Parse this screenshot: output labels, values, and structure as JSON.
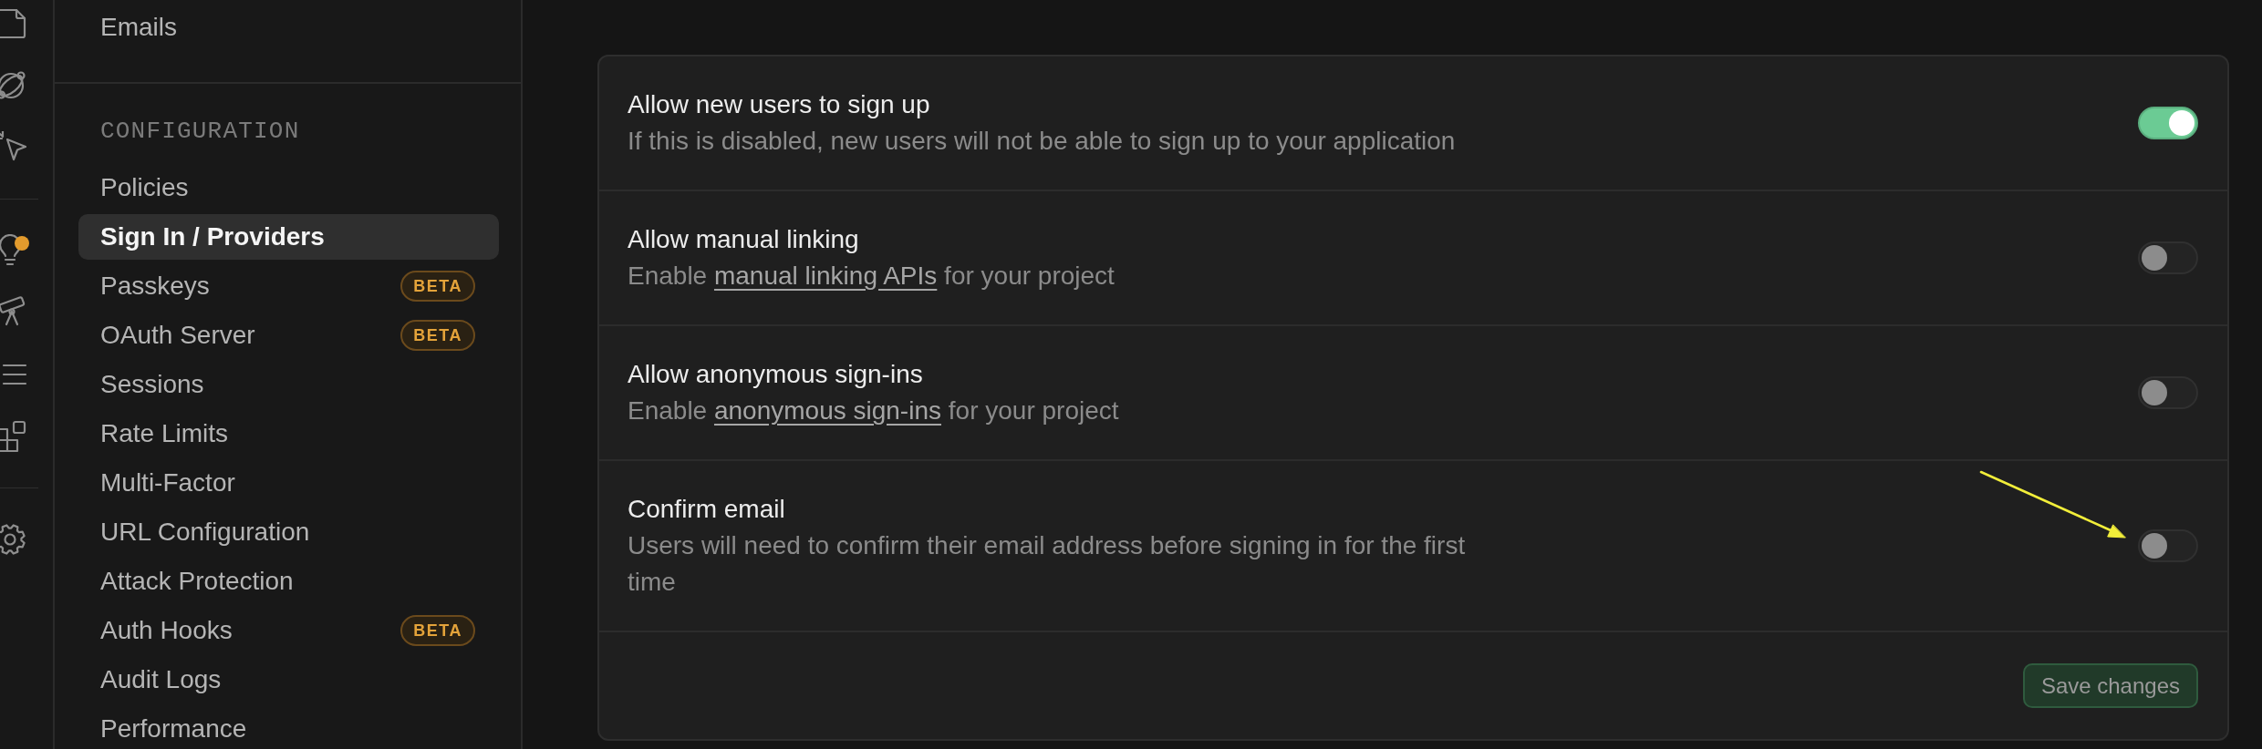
{
  "rail": {
    "items": [
      {
        "kind": "document",
        "dot": false
      },
      {
        "kind": "orbit",
        "dot": false
      },
      {
        "kind": "cursor",
        "dot": false
      },
      {
        "kind": "divider"
      },
      {
        "kind": "bulb",
        "dot": true
      },
      {
        "kind": "telescope",
        "dot": false
      },
      {
        "kind": "list",
        "dot": false
      },
      {
        "kind": "blocks",
        "dot": false
      },
      {
        "kind": "divider"
      },
      {
        "kind": "gear",
        "dot": false
      }
    ]
  },
  "sidebar": {
    "sections": [
      {
        "items": [
          {
            "label": "Emails",
            "selected": false
          }
        ]
      },
      {
        "heading": "CONFIGURATION",
        "items": [
          {
            "label": "Policies",
            "selected": false
          },
          {
            "label": "Sign In / Providers",
            "selected": true
          },
          {
            "label": "Passkeys",
            "selected": false,
            "badge": "BETA"
          },
          {
            "label": "OAuth Server",
            "selected": false,
            "badge": "BETA"
          },
          {
            "label": "Sessions",
            "selected": false
          },
          {
            "label": "Rate Limits",
            "selected": false
          },
          {
            "label": "Multi-Factor",
            "selected": false
          },
          {
            "label": "URL Configuration",
            "selected": false
          },
          {
            "label": "Attack Protection",
            "selected": false
          },
          {
            "label": "Auth Hooks",
            "selected": false,
            "badge": "BETA"
          },
          {
            "label": "Audit Logs",
            "selected": false
          },
          {
            "label": "Performance",
            "selected": false
          }
        ]
      }
    ]
  },
  "settings": [
    {
      "title": "Allow new users to sign up",
      "description": [
        {
          "kind": "text",
          "text": "If this is disabled, new users will not be able to sign up to your application"
        }
      ],
      "on": true,
      "arrow": false
    },
    {
      "title": "Allow manual linking",
      "description": [
        {
          "kind": "text",
          "text": "Enable "
        },
        {
          "kind": "link",
          "text": "manual linking APIs"
        },
        {
          "kind": "text",
          "text": " for your project"
        }
      ],
      "on": false,
      "arrow": false
    },
    {
      "title": "Allow anonymous sign-ins",
      "description": [
        {
          "kind": "text",
          "text": "Enable "
        },
        {
          "kind": "link",
          "text": "anonymous sign-ins"
        },
        {
          "kind": "text",
          "text": " for your project"
        }
      ],
      "on": false,
      "arrow": false
    },
    {
      "title": "Confirm email",
      "description": [
        {
          "kind": "text",
          "text": "Users will need to confirm their email address before signing in for the first time"
        }
      ],
      "on": false,
      "arrow": true
    }
  ],
  "save_button": {
    "label": "Save changes",
    "disabled": true
  }
}
